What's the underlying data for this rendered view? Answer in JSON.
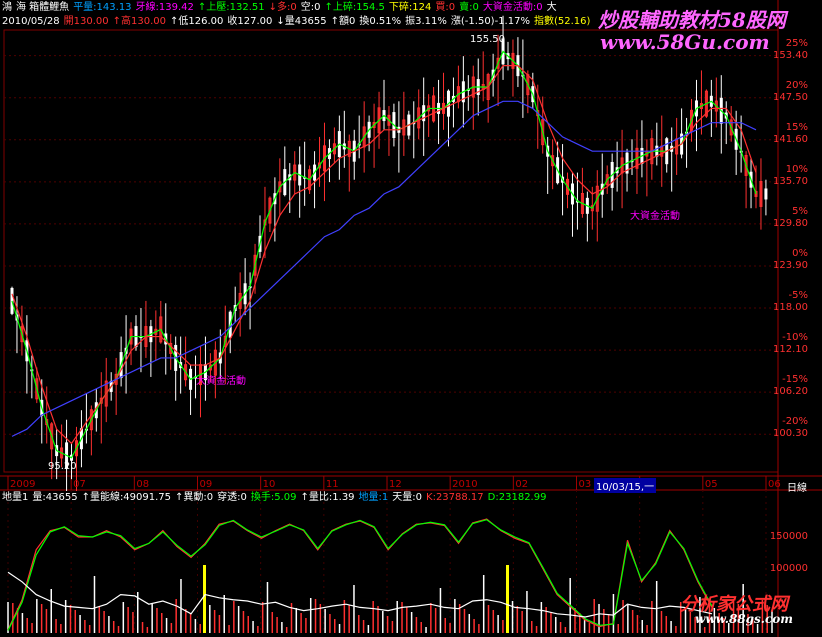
{
  "header": {
    "line1": [
      {
        "text": "鴻",
        "color": "#ffffff"
      },
      {
        "text": "海 箱體鯉魚",
        "color": "#ffffff"
      },
      {
        "text": "平量:143.13",
        "color": "#00a0ff"
      },
      {
        "text": "牙線:139.42",
        "color": "#ff00ff"
      },
      {
        "text": "↑上壓:132.51",
        "color": "#00ff00"
      },
      {
        "text": "↓多:0",
        "color": "#ff3030"
      },
      {
        "text": "空:0",
        "color": "#ffffff"
      },
      {
        "text": "↑上碎:154.5",
        "color": "#00ff00"
      },
      {
        "text": "下碎:124",
        "color": "#ffff00"
      },
      {
        "text": "買:0",
        "color": "#ff3030"
      },
      {
        "text": "賣:0",
        "color": "#00ff00"
      },
      {
        "text": "大資金活動:0",
        "color": "#ff00ff"
      },
      {
        "text": "大",
        "color": "#ffffff"
      }
    ],
    "line2": [
      {
        "text": "2010/05/28",
        "color": "#ffffff"
      },
      {
        "text": "開130.00",
        "color": "#ff3030"
      },
      {
        "text": "↑高130.00",
        "color": "#ff3030"
      },
      {
        "text": "↑低126.00",
        "color": "#ffffff"
      },
      {
        "text": "收127.00",
        "color": "#ffffff"
      },
      {
        "text": "↓量43655",
        "color": "#ffffff"
      },
      {
        "text": "↑額0",
        "color": "#ffffff"
      },
      {
        "text": "換0.51%",
        "color": "#ffffff"
      },
      {
        "text": "振3.11%",
        "color": "#ffffff"
      },
      {
        "text": "漲(-1.50)-1.17%",
        "color": "#ffffff"
      },
      {
        "text": "指數(52.16)",
        "color": "#ffff00"
      }
    ]
  },
  "watermarks": {
    "top": "炒股輔助教材58股网",
    "url": "www.58Gu.com",
    "bottom_cn": "分析家公式网",
    "bottom_url": "www.88gs.com"
  },
  "lower_header": [
    {
      "text": "地量1",
      "color": "#ffffff"
    },
    {
      "text": "量:43655",
      "color": "#ffffff"
    },
    {
      "text": "↑量能線:49091.75",
      "color": "#ffffff"
    },
    {
      "text": "↑異動:0",
      "color": "#ffffff"
    },
    {
      "text": "穿透:0",
      "color": "#ffffff"
    },
    {
      "text": "換手:5.09",
      "color": "#00ff00"
    },
    {
      "text": "↑量比:1.39",
      "color": "#ffffff"
    },
    {
      "text": "地量:1",
      "color": "#00a0ff"
    },
    {
      "text": "天量:0",
      "color": "#ffffff"
    },
    {
      "text": "K:23788.17",
      "color": "#ff3030"
    },
    {
      "text": "D:23182.99",
      "color": "#00ff00"
    }
  ],
  "chart_data": {
    "type": "line",
    "title": "",
    "price_axis": {
      "left_labels": [
        "153.40",
        "147.50",
        "141.60",
        "135.70",
        "129.80",
        "123.90",
        "118.00",
        "112.10",
        "106.20",
        "100.30"
      ],
      "pct_labels": [
        "25%",
        "20%",
        "15%",
        "10%",
        "5%",
        "0%",
        "-5%",
        "-10%",
        "-15%",
        "-20%"
      ],
      "ylim": [
        95,
        157
      ]
    },
    "volume_axis": {
      "labels": [
        "150000",
        "100000"
      ],
      "ylim": [
        0,
        200000
      ]
    },
    "x_labels": [
      "2009",
      "07",
      "08",
      "09",
      "10",
      "11",
      "12",
      "2010",
      "02",
      "03",
      "04",
      "05",
      "06"
    ],
    "x_selected": "10/03/15,一",
    "x_axis_name": "日線",
    "annotations": [
      {
        "text": "155.50",
        "x": "2010-01-08",
        "y": 155.5
      },
      {
        "text": "95.20",
        "x": "2009-07-01",
        "y": 95.2
      },
      {
        "text": "大資金活動",
        "x": "2009-09-20",
        "y": 108.0
      },
      {
        "text": "大資金活動",
        "x": "2010-03-25",
        "y": 131.0
      }
    ],
    "series": [
      {
        "color": "#00ff00",
        "values": [
          119,
          112,
          104,
          98,
          97,
          101,
          105,
          108,
          114,
          114,
          115,
          111,
          108,
          109,
          111,
          118,
          121,
          130,
          135,
          137,
          136,
          139,
          141,
          140,
          143,
          145,
          143,
          144,
          146,
          146,
          148,
          149,
          149,
          154,
          152,
          148,
          140,
          136,
          133,
          132,
          136,
          138,
          139,
          140,
          140,
          141,
          146,
          147,
          145,
          140,
          134
        ]
      },
      {
        "color": "#ff3030",
        "values": [
          120,
          114,
          107,
          101,
          99,
          102,
          105,
          108,
          112,
          114,
          114,
          112,
          110,
          110,
          111,
          115,
          119,
          126,
          131,
          134,
          135,
          137,
          139,
          140,
          141,
          143,
          143,
          144,
          145,
          146,
          147,
          148,
          149,
          152,
          152,
          150,
          144,
          139,
          136,
          134,
          135,
          137,
          138,
          139,
          140,
          141,
          144,
          146,
          146,
          143,
          137
        ]
      },
      {
        "color": "#4040ff",
        "values": [
          100,
          101,
          103,
          104,
          105,
          106,
          107,
          108,
          109,
          110,
          111,
          111,
          112,
          113,
          114,
          116,
          118,
          120,
          122,
          124,
          126,
          128,
          129,
          131,
          132,
          134,
          135,
          137,
          139,
          141,
          143,
          145,
          146,
          147,
          147,
          146,
          144,
          142,
          141,
          140,
          140,
          140,
          140,
          140,
          141,
          142,
          143,
          144,
          144,
          144,
          143
        ]
      }
    ],
    "volume_series": [
      {
        "name": "K",
        "color": "#ff3030",
        "values": [
          5000,
          52000,
          130000,
          160000,
          165000,
          150000,
          150000,
          160000,
          150000,
          130000,
          140000,
          160000,
          135000,
          118000,
          140000,
          170000,
          175000,
          160000,
          148000,
          160000,
          170000,
          160000,
          130000,
          160000,
          170000,
          175000,
          165000,
          130000,
          155000,
          170000,
          172000,
          168000,
          140000,
          172000,
          178000,
          160000,
          148000,
          140000,
          100000,
          60000,
          40000,
          20000,
          10000,
          15000,
          145000,
          80000,
          110000,
          160000,
          130000,
          80000,
          40000
        ]
      },
      {
        "name": "D",
        "color": "#00ff00",
        "values": [
          4000,
          48000,
          122000,
          158000,
          166000,
          152000,
          150000,
          158000,
          152000,
          132000,
          140000,
          158000,
          137000,
          120000,
          138000,
          168000,
          176000,
          161000,
          150000,
          159000,
          169000,
          161000,
          132000,
          159000,
          169000,
          176000,
          166000,
          132000,
          154000,
          169000,
          173000,
          169000,
          142000,
          171000,
          177000,
          161000,
          150000,
          141000,
          102000,
          62000,
          42000,
          22000,
          12000,
          14000,
          140000,
          82000,
          108000,
          158000,
          132000,
          82000,
          42000
        ]
      },
      {
        "name": "量能線",
        "color": "#ffffff",
        "values": [
          95000,
          80000,
          60000,
          50000,
          42000,
          40000,
          38000,
          45000,
          60000,
          58000,
          45000,
          50000,
          42000,
          30000,
          60000,
          55000,
          52000,
          50000,
          45000,
          48000,
          40000,
          35000,
          38000,
          42000,
          45000,
          40000,
          38000,
          35000,
          40000,
          42000,
          45000,
          40000,
          38000,
          50000,
          52000,
          48000,
          40000,
          38000,
          35000,
          30000,
          28000,
          25000,
          30000,
          28000,
          45000,
          40000,
          38000,
          42000,
          40000,
          35000,
          30000
        ]
      }
    ]
  }
}
